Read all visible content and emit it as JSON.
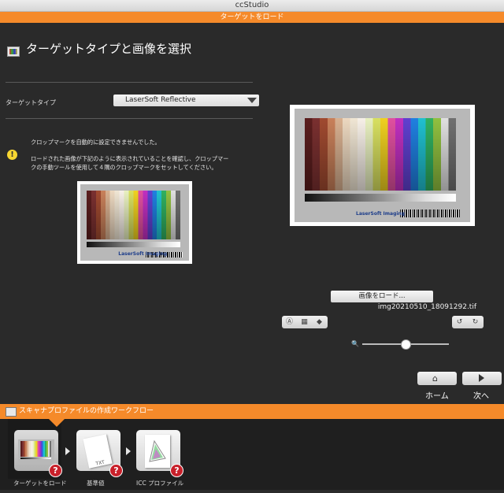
{
  "app": {
    "window_title": "ccStudio",
    "section_title": "ターゲットをロード"
  },
  "page": {
    "title": "ターゲットタイプと画像を選択"
  },
  "target_type": {
    "label": "ターゲットタイプ",
    "selected": "LaserSoft Reflective"
  },
  "messages": {
    "line1": "クロップマークを自動的に設定できませんでした。",
    "line2": "ロードされた画像が下記のように表示されていることを確認し、クロップマー",
    "line3": "クの手動ツールを使用して４隅のクロップマークをセットしてください。"
  },
  "image": {
    "filename": "img20210510_18091292.tif",
    "load_button": "画像をロード..."
  },
  "nav": {
    "home": "ホーム",
    "next": "次へ"
  },
  "workflow": {
    "title": "スキャナプロファイルの作成ワークフロー",
    "steps": [
      {
        "label": "ターゲットをロード",
        "badge": "?"
      },
      {
        "label": "基準値",
        "badge": "?"
      },
      {
        "label": "ICC プロファイル",
        "badge": "?"
      }
    ]
  },
  "icons": [
    "crop-icon",
    "grid-icon",
    "tag-icon",
    "zoom-icon",
    "rotate-left-icon",
    "rotate-right-icon",
    "home-icon",
    "next-arrow-icon"
  ],
  "colors": {
    "accent": "#f58a2a",
    "background": "#2a2a2a",
    "badge": "#c8202a"
  }
}
